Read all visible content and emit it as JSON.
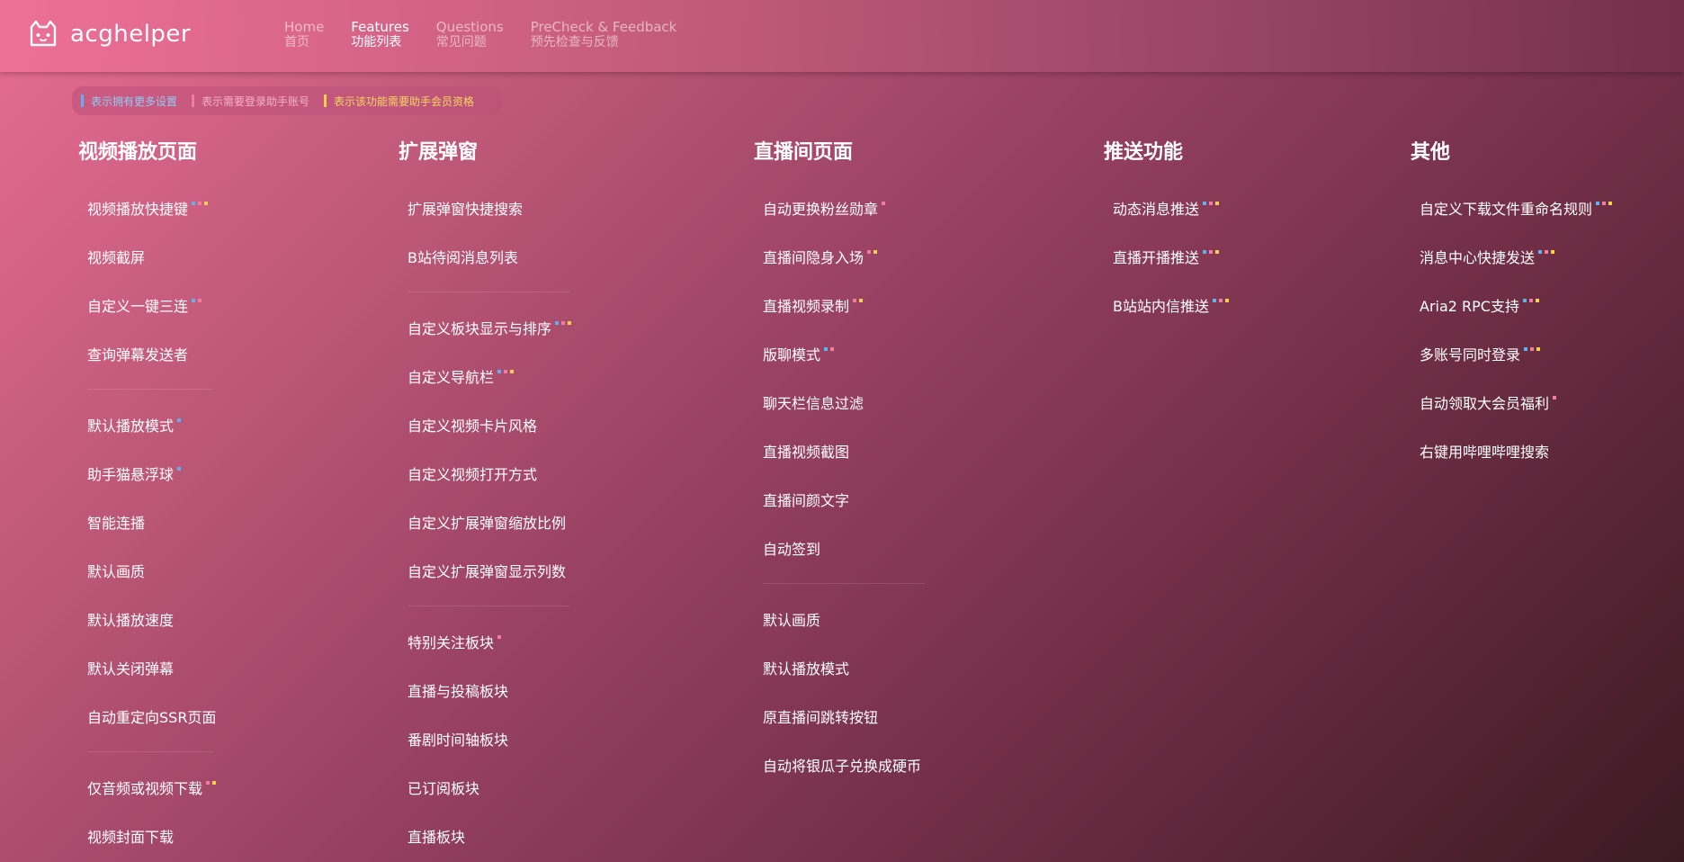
{
  "app": {
    "logo_text": "acghelper"
  },
  "nav": [
    {
      "en": "Home",
      "zh": "首页",
      "active": false
    },
    {
      "en": "Features",
      "zh": "功能列表",
      "active": true
    },
    {
      "en": "Questions",
      "zh": "常见问题",
      "active": false
    },
    {
      "en": "PreCheck & Feedback",
      "zh": "预先检查与反馈",
      "active": false
    }
  ],
  "legend": {
    "more_settings": "表示拥有更多设置",
    "login_required": "表示需要登录助手账号",
    "member_required": "表示该功能需要助手会员资格"
  },
  "colors": {
    "more_settings": "#5ab4f0",
    "login_required": "#f07ca0",
    "member_required": "#f2d24a"
  },
  "columns": [
    {
      "title": "视频播放页面",
      "groups": [
        [
          {
            "label": "视频播放快捷键",
            "marks": [
              "blue",
              "pink",
              "yellow"
            ]
          },
          {
            "label": "视频截屏",
            "marks": []
          },
          {
            "label": "自定义一键三连",
            "marks": [
              "blue",
              "pink"
            ]
          },
          {
            "label": "查询弹幕发送者",
            "marks": []
          }
        ],
        [
          {
            "label": "默认播放模式",
            "marks": [
              "blue"
            ]
          },
          {
            "label": "助手猫悬浮球",
            "marks": [
              "blue"
            ]
          },
          {
            "label": "智能连播",
            "marks": []
          },
          {
            "label": "默认画质",
            "marks": []
          },
          {
            "label": "默认播放速度",
            "marks": []
          },
          {
            "label": "默认关闭弹幕",
            "marks": []
          },
          {
            "label": "自动重定向SSR页面",
            "marks": []
          }
        ],
        [
          {
            "label": "仅音频或视频下载",
            "marks": [
              "pink",
              "yellow"
            ]
          },
          {
            "label": "视频封面下载",
            "marks": []
          }
        ]
      ]
    },
    {
      "title": "扩展弹窗",
      "groups": [
        [
          {
            "label": "扩展弹窗快捷搜索",
            "marks": []
          },
          {
            "label": "B站待阅消息列表",
            "marks": []
          }
        ],
        [
          {
            "label": "自定义板块显示与排序",
            "marks": [
              "blue",
              "pink",
              "yellow"
            ]
          },
          {
            "label": "自定义导航栏",
            "marks": [
              "blue",
              "pink",
              "yellow"
            ]
          },
          {
            "label": "自定义视频卡片风格",
            "marks": []
          },
          {
            "label": "自定义视频打开方式",
            "marks": []
          },
          {
            "label": "自定义扩展弹窗缩放比例",
            "marks": []
          },
          {
            "label": "自定义扩展弹窗显示列数",
            "marks": []
          }
        ],
        [
          {
            "label": "特别关注板块",
            "marks": [
              "pink"
            ]
          },
          {
            "label": "直播与投稿板块",
            "marks": []
          },
          {
            "label": "番剧时间轴板块",
            "marks": []
          },
          {
            "label": "已订阅板块",
            "marks": []
          },
          {
            "label": "直播板块",
            "marks": []
          }
        ]
      ]
    },
    {
      "title": "直播间页面",
      "groups": [
        [
          {
            "label": "自动更换粉丝勋章",
            "marks": [
              "pink"
            ]
          },
          {
            "label": "直播间隐身入场",
            "marks": [
              "pink",
              "yellow"
            ]
          },
          {
            "label": "直播视频录制",
            "marks": [
              "pink",
              "yellow"
            ]
          },
          {
            "label": "版聊模式",
            "marks": [
              "blue",
              "pink"
            ]
          },
          {
            "label": "聊天栏信息过滤",
            "marks": []
          },
          {
            "label": "直播视频截图",
            "marks": []
          },
          {
            "label": "直播间颜文字",
            "marks": []
          },
          {
            "label": "自动签到",
            "marks": []
          }
        ],
        [
          {
            "label": "默认画质",
            "marks": []
          },
          {
            "label": "默认播放模式",
            "marks": []
          },
          {
            "label": "原直播间跳转按钮",
            "marks": []
          },
          {
            "label": "自动将银瓜子兑换成硬币",
            "marks": []
          }
        ]
      ]
    },
    {
      "title": "推送功能",
      "groups": [
        [
          {
            "label": "动态消息推送",
            "marks": [
              "blue",
              "pink",
              "yellow"
            ]
          },
          {
            "label": "直播开播推送",
            "marks": [
              "blue",
              "pink",
              "yellow"
            ]
          },
          {
            "label": "B站站内信推送",
            "marks": [
              "blue",
              "pink",
              "yellow"
            ]
          }
        ]
      ]
    },
    {
      "title": "其他",
      "groups": [
        [
          {
            "label": "自定义下载文件重命名规则",
            "marks": [
              "blue",
              "pink",
              "yellow"
            ]
          },
          {
            "label": "消息中心快捷发送",
            "marks": [
              "blue",
              "pink",
              "yellow"
            ]
          },
          {
            "label": "Aria2 RPC支持",
            "marks": [
              "blue",
              "pink",
              "yellow"
            ]
          },
          {
            "label": "多账号同时登录",
            "marks": [
              "blue",
              "pink",
              "yellow"
            ]
          },
          {
            "label": "自动领取大会员福利",
            "marks": [
              "pink"
            ]
          },
          {
            "label": "右键用哔哩哔哩搜索",
            "marks": []
          }
        ]
      ]
    }
  ]
}
